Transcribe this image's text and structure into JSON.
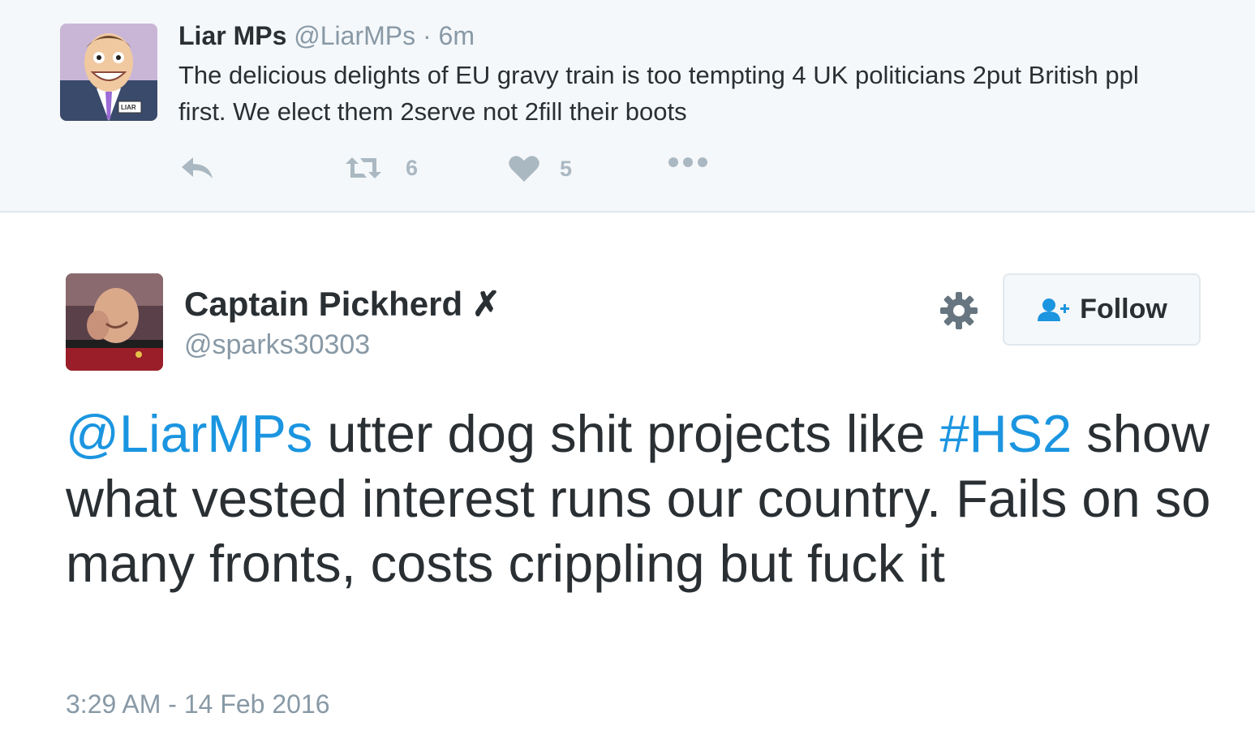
{
  "parent_tweet": {
    "name": "Liar MPs",
    "handle": "@LiarMPs",
    "separator": "·",
    "time": "6m",
    "text": "The delicious delights of EU gravy train is too tempting 4 UK politicians 2put British ppl first. We elect them 2serve not 2fill their boots",
    "avatar_badge": "LIAR",
    "actions": {
      "reply_icon": "reply-icon",
      "retweet_icon": "retweet-icon",
      "retweet_count": "6",
      "like_icon": "heart-icon",
      "like_count": "5",
      "more_icon": "more-icon"
    }
  },
  "main_tweet": {
    "name": "Captain Pickherd",
    "name_suffix": "✗",
    "handle": "@sparks30303",
    "text_mention": "@LiarMPs",
    "text_part1": " utter dog shit projects like ",
    "text_hashtag": "#HS2",
    "text_part2": " show what vested interest runs our country. Fails on so many fronts, costs crippling but fuck it",
    "timestamp": "3:29 AM - 14 Feb 2016",
    "follow_label": "Follow",
    "gear_icon": "gear-icon",
    "follow_icon": "add-user-icon"
  },
  "colors": {
    "link": "#1b95e0",
    "muted": "#8899a6",
    "action_gray": "#aab8c2",
    "parent_bg": "#f5f8fa"
  }
}
